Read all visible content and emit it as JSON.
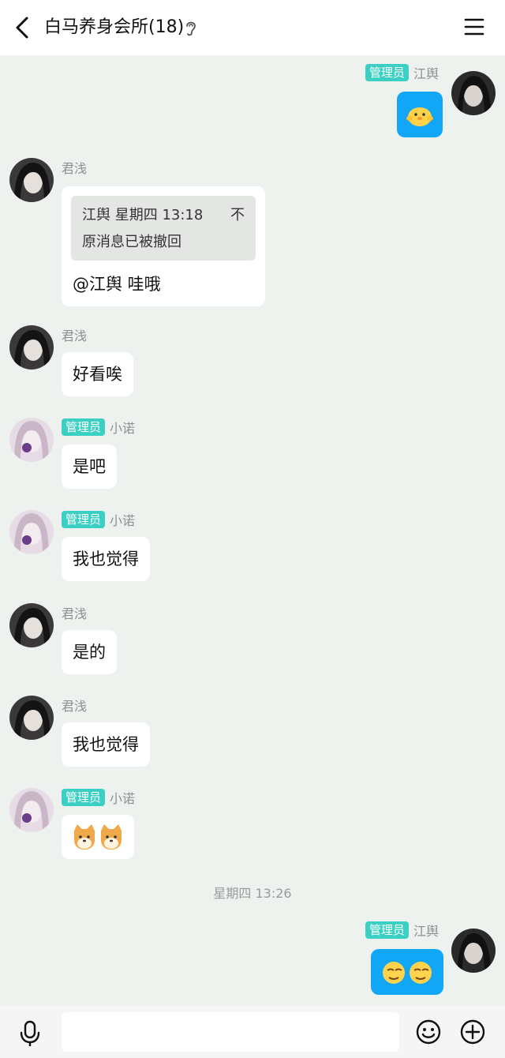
{
  "header": {
    "title": "白马养身会所(18)"
  },
  "messages": [
    {
      "sender": "江舆",
      "role": "管理员"
    },
    {
      "sender": "君浅",
      "quote_header": "江舆 星期四 13:18",
      "quote_pin": "不",
      "quote_body": "原消息已被撤回",
      "text": "@江舆 哇哦"
    },
    {
      "sender": "君浅",
      "text": "好看唉"
    },
    {
      "sender": "小诺",
      "role": "管理员",
      "text": "是吧"
    },
    {
      "sender": "小诺",
      "role": "管理员",
      "text": "我也觉得"
    },
    {
      "sender": "君浅",
      "text": "是的"
    },
    {
      "sender": "君浅",
      "text": "我也觉得"
    },
    {
      "sender": "小诺",
      "role": "管理员"
    },
    {
      "sender": "江舆",
      "role": "管理员"
    }
  ],
  "timestamp": "星期四 13:26",
  "input": {
    "placeholder": ""
  },
  "colors": {
    "admin_badge": "#3ccfc3",
    "own_bubble": "#12a7f6",
    "background": "#eef2ee"
  }
}
